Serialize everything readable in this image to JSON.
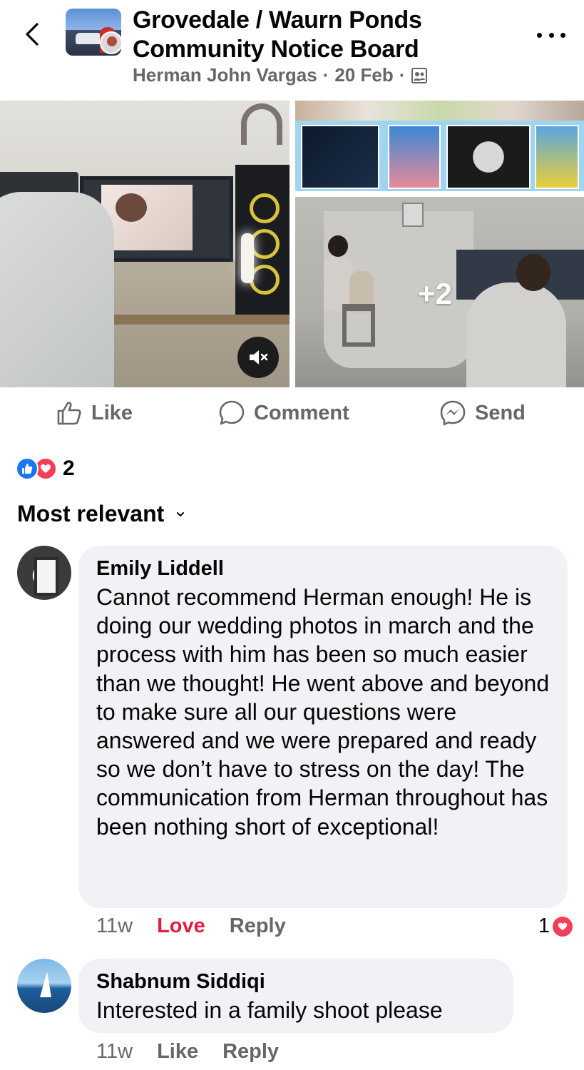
{
  "header": {
    "group_title": "Grovedale / Waurn Ponds Community Notice Board",
    "author": "Herman John Vargas",
    "date": "20 Feb",
    "separator": "·",
    "audience_icon": "group-members-icon"
  },
  "media": {
    "more_count": "+2",
    "video_muted": true
  },
  "actions": {
    "like_label": "Like",
    "comment_label": "Comment",
    "send_label": "Send"
  },
  "reactions": {
    "types": [
      "like",
      "love"
    ],
    "count": "2"
  },
  "sort": {
    "label": "Most relevant"
  },
  "comments": [
    {
      "author": "Emily Liddell",
      "text": "Cannot recommend Herman enough! He is doing our wedding photos in march and the process with him has been so much easier than we thought! He went above and beyond to make sure all our questions were answered and we were prepared and ready so we don’t have to stress on the day! The communication from Herman throughout has been nothing short of exceptional!",
      "time": "11w",
      "reaction_label": "Love",
      "reply_label": "Reply",
      "reaction_count": "1"
    },
    {
      "author": "Shabnum Siddiqi",
      "text": "Interested in a family shoot please",
      "time": "11w",
      "reaction_label": "Like",
      "reply_label": "Reply"
    }
  ],
  "colors": {
    "accent_blue": "#1877f2",
    "love_red": "#e41e3f",
    "secondary_text": "#65676b",
    "bubble_bg": "#f0f2f5"
  }
}
